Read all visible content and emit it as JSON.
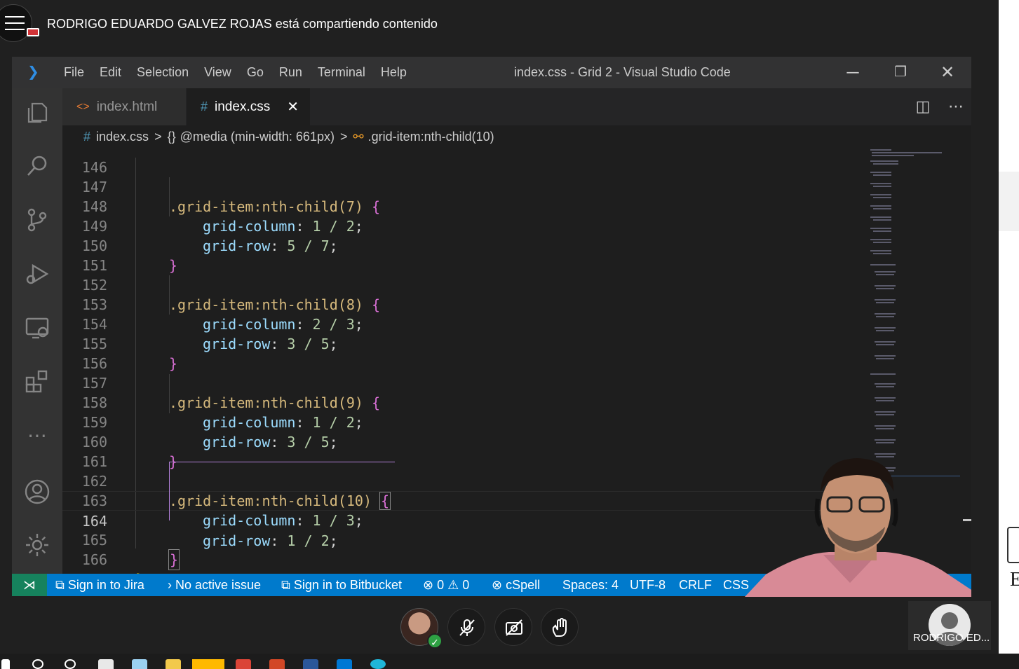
{
  "meeting": {
    "share_notice": "RODRIGO EDUARDO GALVEZ ROJAS está compartiendo contenido",
    "participant_name": "RODRIGO ED..."
  },
  "vscode": {
    "window_title": "index.css - Grid 2 - Visual Studio Code",
    "menu": [
      "File",
      "Edit",
      "Selection",
      "View",
      "Go",
      "Run",
      "Terminal",
      "Help"
    ],
    "tabs": [
      {
        "label": "index.html",
        "icon": "html-file-icon",
        "active": false
      },
      {
        "label": "index.css",
        "icon": "css-file-icon",
        "active": true
      }
    ],
    "breadcrumb": {
      "file": "index.css",
      "media": "@media (min-width: 661px)",
      "selector": ".grid-item:nth-child(10)"
    },
    "code_lines": [
      {
        "n": "146",
        "text": ""
      },
      {
        "n": "147",
        "selector": ".grid-item:nth-child(7)",
        "brace": "{"
      },
      {
        "n": "148",
        "prop": "grid-column",
        "value": "1 / 2"
      },
      {
        "n": "149",
        "prop": "grid-row",
        "value": "5 / 7"
      },
      {
        "n": "150",
        "brace": "}"
      },
      {
        "n": "151",
        "text": ""
      },
      {
        "n": "152",
        "selector": ".grid-item:nth-child(8)",
        "brace": "{"
      },
      {
        "n": "153",
        "prop": "grid-column",
        "value": "2 / 3"
      },
      {
        "n": "154",
        "prop": "grid-row",
        "value": "3 / 5"
      },
      {
        "n": "155",
        "brace": "}"
      },
      {
        "n": "156",
        "text": ""
      },
      {
        "n": "157",
        "selector": ".grid-item:nth-child(9)",
        "brace": "{"
      },
      {
        "n": "158",
        "prop": "grid-column",
        "value": "1 / 2"
      },
      {
        "n": "159",
        "prop": "grid-row",
        "value": "3 / 5"
      },
      {
        "n": "160",
        "brace": "}"
      },
      {
        "n": "161",
        "text": ""
      },
      {
        "n": "162",
        "selector": ".grid-item:nth-child(10)",
        "brace": "{"
      },
      {
        "n": "163",
        "prop": "grid-column",
        "value": "1 / 3"
      },
      {
        "n": "164",
        "prop": "grid-row",
        "value": "1 / 2"
      },
      {
        "n": "165",
        "brace": "}"
      },
      {
        "n": "166",
        "closing": "}"
      }
    ],
    "status": {
      "jira": "Sign in to Jira",
      "issue": "No active issue",
      "bitbucket": "Sign in to Bitbucket",
      "errors": "0",
      "warnings": "0",
      "spell": "cSpell",
      "spaces": "Spaces: 4",
      "encoding": "UTF-8",
      "eol": "CRLF",
      "language": "CSS"
    }
  },
  "colors": {
    "statusbar": "#007acc",
    "selector": "#d7ba7d",
    "property": "#9cdcfe",
    "number": "#b5cea8"
  }
}
